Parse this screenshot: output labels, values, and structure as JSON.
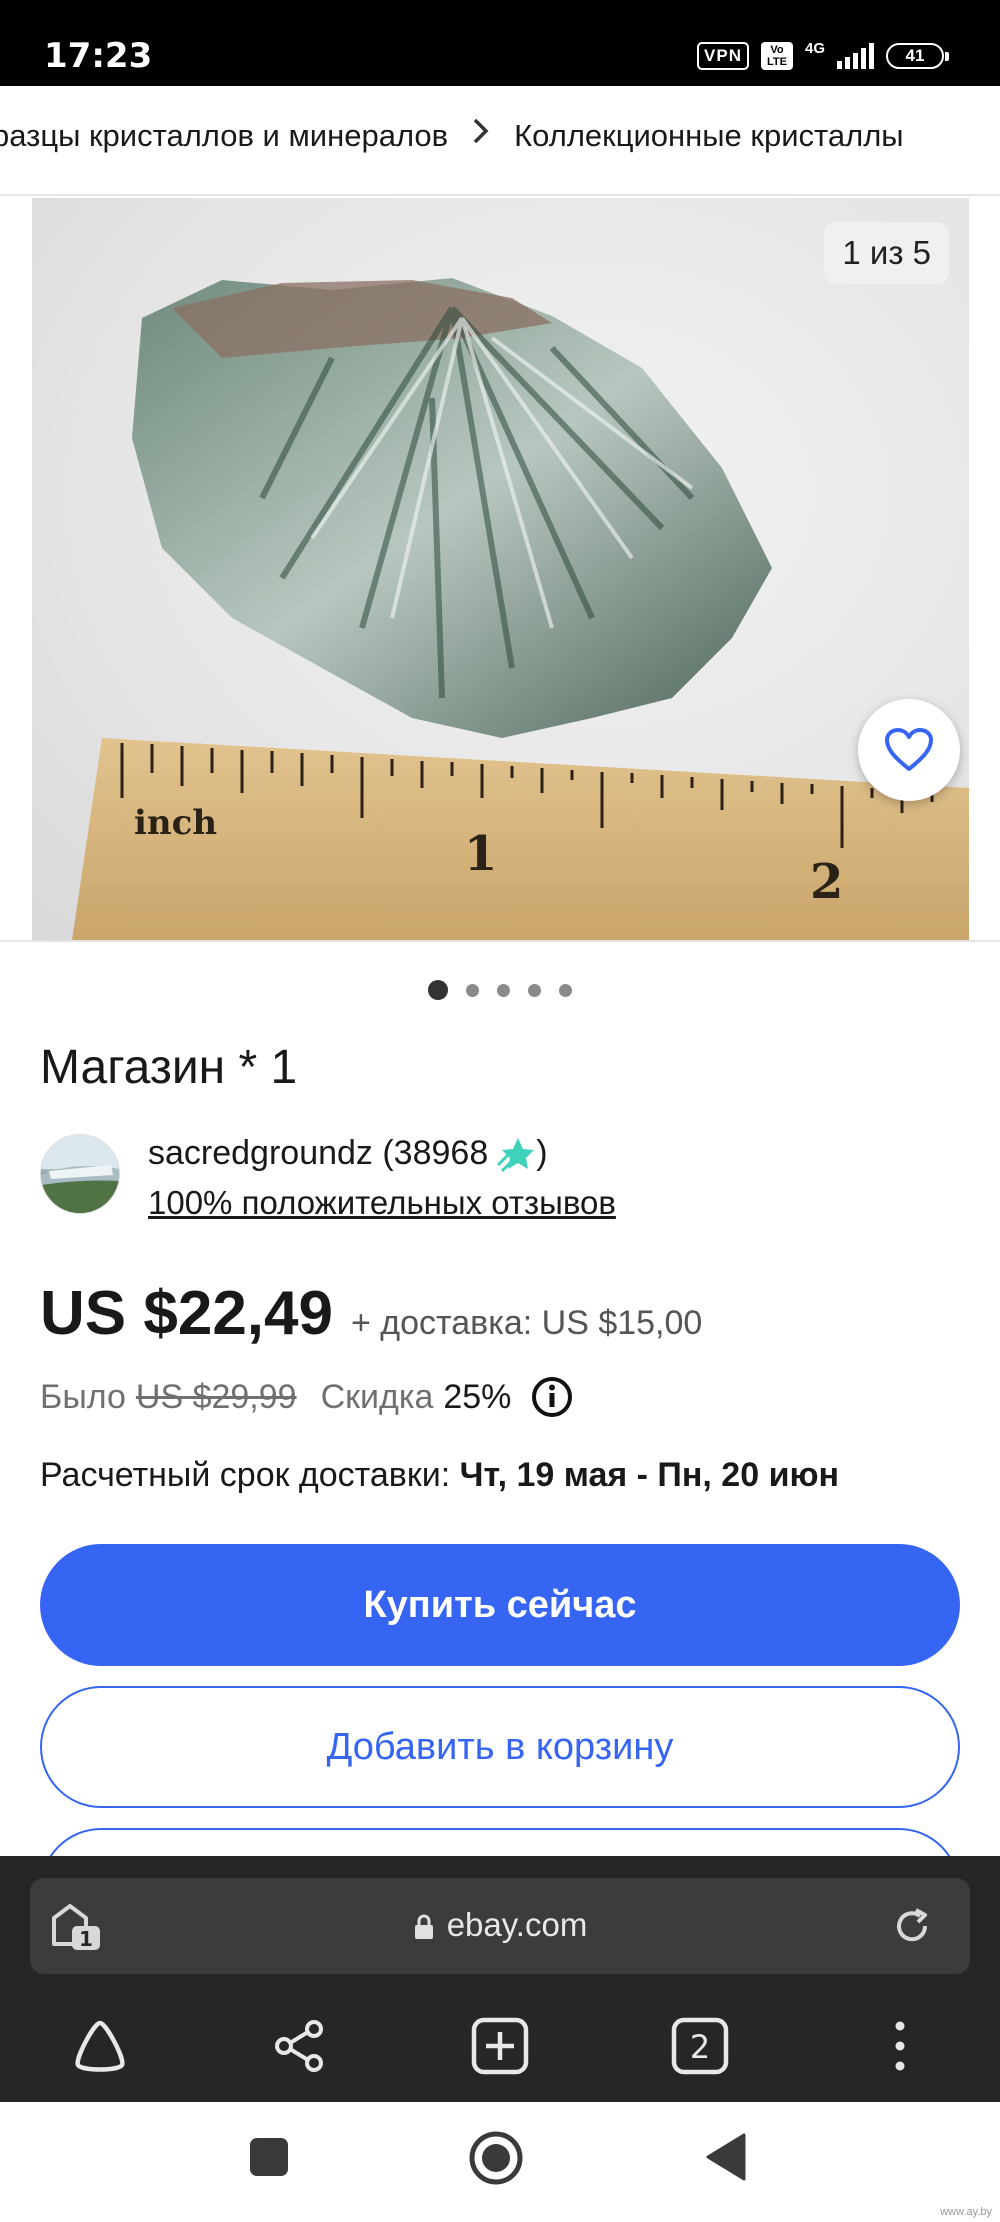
{
  "status_bar": {
    "time": "17:23",
    "vpn": "VPN",
    "volte": "Vo LTE",
    "network": "4G",
    "battery": "41"
  },
  "breadcrumb": {
    "items": [
      "разцы кристаллов и минералов",
      "Коллекционные кристаллы"
    ]
  },
  "gallery": {
    "counter": "1 из 5",
    "ruler_label": "inch",
    "ruler_marks": [
      "1",
      "2"
    ],
    "dot_count": 5,
    "active_dot": 0
  },
  "listing": {
    "title": "Магазин * 1",
    "seller_name": "sacredgroundz (38968",
    "seller_name_close": ")",
    "seller_feedback": "100% положительных отзывов",
    "price": "US $22,49",
    "shipping": "+ доставка: US $15,00",
    "was_label": "Было",
    "was_price": "US $29,99",
    "discount_label": "Скидка",
    "discount_value": "25%",
    "delivery_label": "Расчетный срок доставки:",
    "delivery_dates": "Чт, 19 мая - Пн, 20 июн"
  },
  "actions": {
    "buy_now": "Купить сейчас",
    "add_to_cart": "Добавить в корзину"
  },
  "browser": {
    "url": "ebay.com",
    "tab_count": "2",
    "tab_badge": "1"
  },
  "watermark": "www.ay.by",
  "colors": {
    "accent": "#3665f3",
    "star": "#3fd1b9",
    "browser_bg": "#262626"
  },
  "icons": {
    "favorite": "heart-icon",
    "info": "info-icon",
    "star": "seller-star-icon",
    "lock": "lock-icon",
    "reload": "reload-icon",
    "home": "browser-home-icon",
    "share": "share-icon",
    "new_tab": "new-tab-icon",
    "tabs": "tabs-icon",
    "menu": "menu-icon"
  }
}
